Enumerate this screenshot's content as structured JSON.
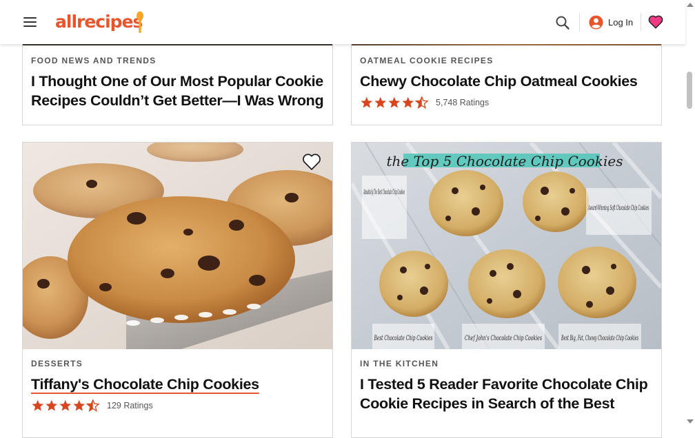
{
  "header": {
    "logo_text": "allrecipes",
    "login_label": "Log In",
    "icons": [
      "menu-icon",
      "search-icon",
      "account-icon",
      "heart-icon"
    ],
    "accent_color": "#e8542c",
    "heart_color": "#ee3b83"
  },
  "cards": [
    {
      "category": "FOOD NEWS AND TRENDS",
      "title": "I Thought One of Our Most Popular Cookie Recipes Couldn’t Get Better—I Was Wrong"
    },
    {
      "category": "OATMEAL COOKIE RECIPES",
      "title": "Chewy Chocolate Chip Oatmeal Cookies",
      "rating": 4.5,
      "ratings_label": "5,748 Ratings"
    },
    {
      "category": "DESSERTS",
      "title": "Tiffany's Chocolate Chip Cookies",
      "rating": 4.5,
      "ratings_label": "129 Ratings"
    },
    {
      "category": "IN THE KITCHEN",
      "title": "I Tested 5 Reader Favorite Chocolate Chip Cookie Recipes in Search of the Best"
    }
  ],
  "image_text": {
    "banner": "the Top 5 Chocolate Chip Cookies",
    "labels": [
      "Absolutely The Best Chocolate Chip Cookies",
      "Award-Winning Soft Chocolate Chip Cookies",
      "Best Chocolate Chip Cookies",
      "Chef John's Chocolate Chip Cookies",
      "Best Big, Fat, Chewy Chocolate Chip Cookies"
    ]
  }
}
